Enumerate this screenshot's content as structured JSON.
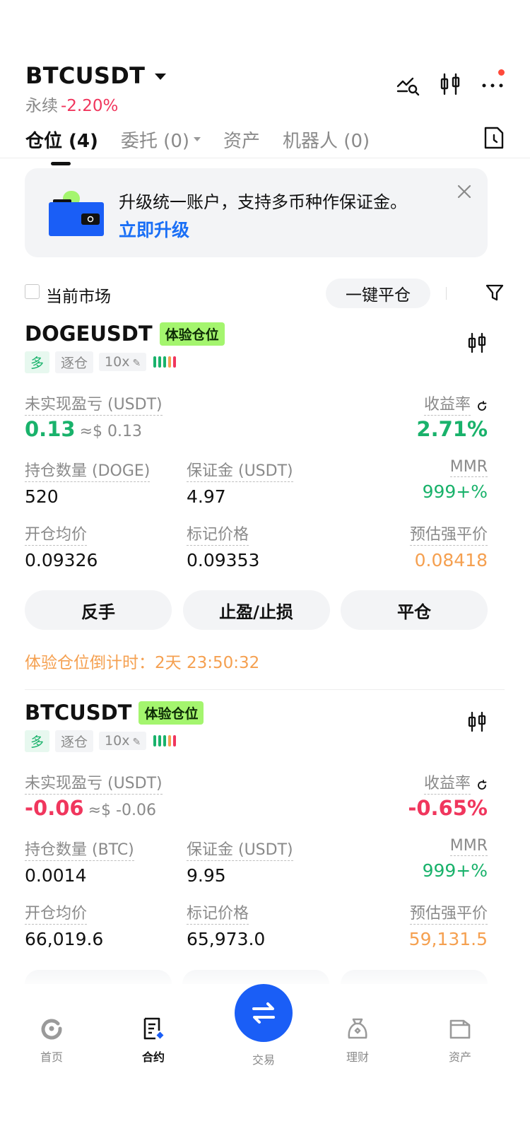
{
  "header": {
    "pair": "BTCUSDT",
    "type_label": "永续",
    "change": "-2.20%",
    "icons": [
      "strategy-icon",
      "candle-chart-icon",
      "more-icon"
    ]
  },
  "tabs": [
    {
      "label": "仓位 (4)",
      "active": true
    },
    {
      "label": "委托 (0)",
      "active": false
    },
    {
      "label": "资产",
      "active": false
    },
    {
      "label": "机器人 (0)",
      "active": false
    }
  ],
  "banner": {
    "text": "升级统一账户，支持多币种作保证金。",
    "link": "立即升级"
  },
  "filter": {
    "current_market": "当前市场",
    "close_all": "一键平仓"
  },
  "positions": [
    {
      "symbol": "DOGEUSDT",
      "badge": "体验仓位",
      "side": "多",
      "margin_mode": "逐仓",
      "leverage": "10x",
      "pnl_label": "未实现盈亏 (USDT)",
      "pnl": "0.13",
      "pnl_approx": "≈$ 0.13",
      "roe_label": "收益率",
      "roe": "2.71%",
      "size_label": "持仓数量 (DOGE)",
      "size": "520",
      "margin_label": "保证金 (USDT)",
      "margin": "4.97",
      "mmr_label": "MMR",
      "mmr": "999+%",
      "entry_label": "开仓均价",
      "entry": "0.09326",
      "mark_label": "标记价格",
      "mark": "0.09353",
      "liq_label": "预估强平价",
      "liq": "0.08418",
      "btn_reverse": "反手",
      "btn_tpsl": "止盈/止损",
      "btn_close": "平仓",
      "countdown_label": "体验仓位倒计时：",
      "countdown": "2天 23:50:32"
    },
    {
      "symbol": "BTCUSDT",
      "badge": "体验仓位",
      "side": "多",
      "margin_mode": "逐仓",
      "leverage": "10x",
      "pnl_label": "未实现盈亏 (USDT)",
      "pnl": "-0.06",
      "pnl_approx": "≈$ -0.06",
      "roe_label": "收益率",
      "roe": "-0.65%",
      "size_label": "持仓数量 (BTC)",
      "size": "0.0014",
      "margin_label": "保证金 (USDT)",
      "margin": "9.95",
      "mmr_label": "MMR",
      "mmr": "999+%",
      "entry_label": "开仓均价",
      "entry": "66,019.6",
      "mark_label": "标记价格",
      "mark": "65,973.0",
      "liq_label": "预估强平价",
      "liq": "59,131.5"
    }
  ],
  "bottom_nav": [
    {
      "label": "首页",
      "icon": "home-icon"
    },
    {
      "label": "合约",
      "icon": "contract-icon",
      "active": true
    },
    {
      "label": "交易",
      "icon": "swap-icon"
    },
    {
      "label": "理财",
      "icon": "earn-icon"
    },
    {
      "label": "资产",
      "icon": "wallet-icon"
    }
  ],
  "colors": {
    "up": "#19b26b",
    "down": "#f0365d",
    "warning": "#f5a050",
    "accent": "#1a5ef6",
    "badge": "#a4f56e"
  }
}
